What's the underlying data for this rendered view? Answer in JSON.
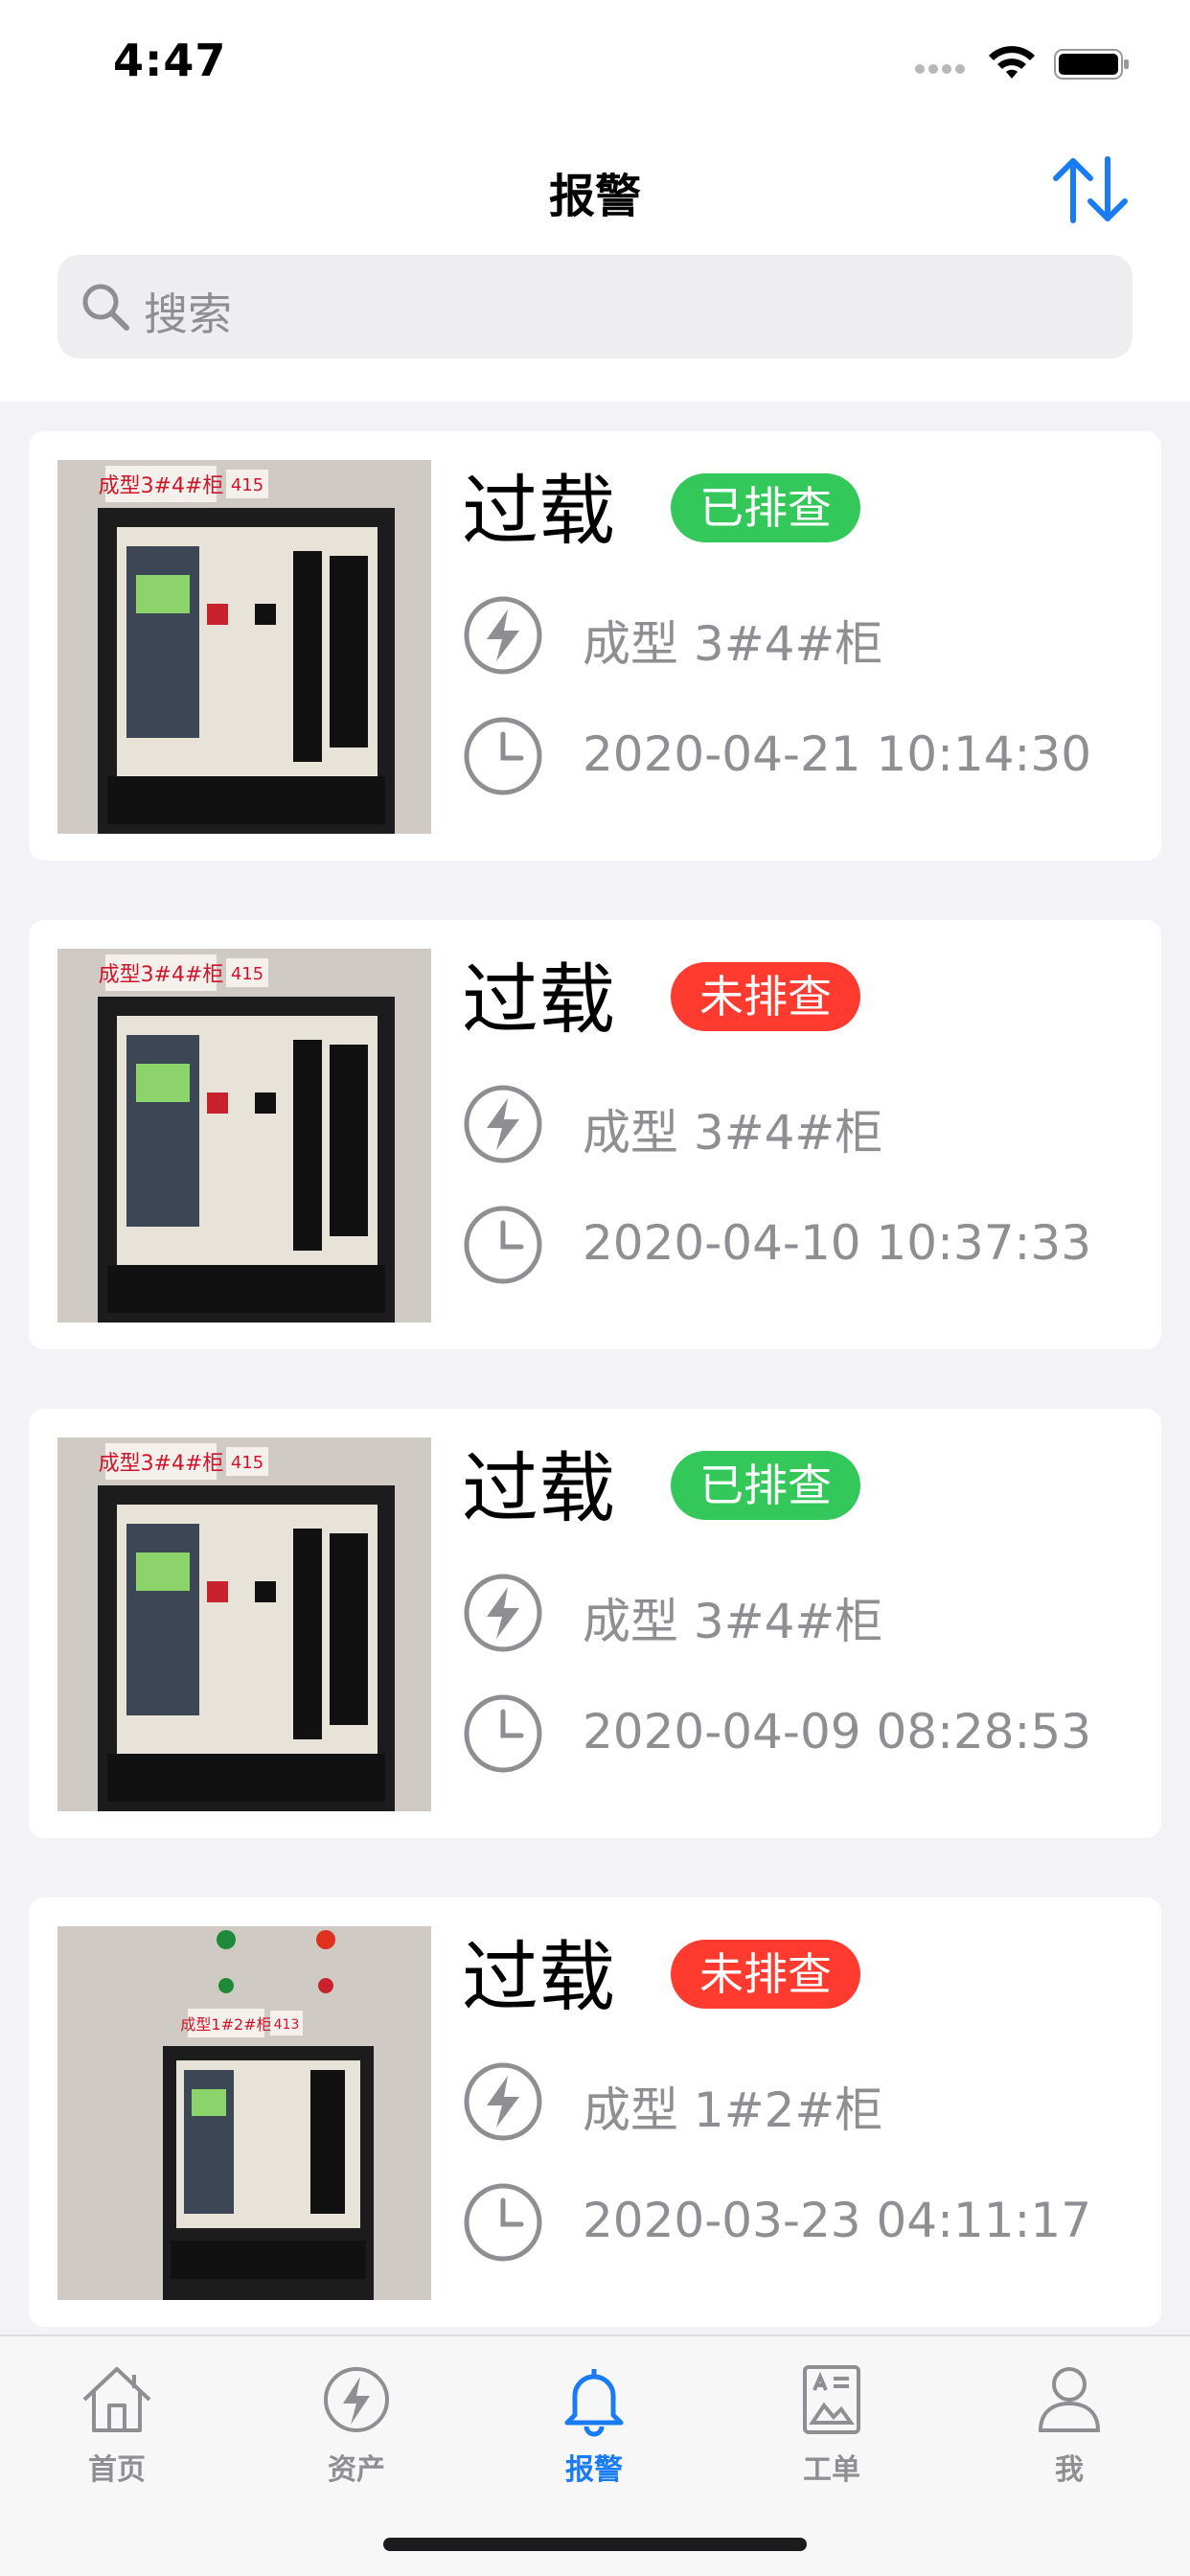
{
  "status_bar": {
    "time": "4:47"
  },
  "header": {
    "title": "报警",
    "sort_icon": "sort-arrows-icon"
  },
  "search": {
    "placeholder": "搜索"
  },
  "colors": {
    "accent": "#1a7cf5",
    "badge_done": "#34c759",
    "badge_pending": "#ff3b30",
    "secondary_text": "#8e8e93",
    "background": "#f2f2f7"
  },
  "alarms": [
    {
      "title": "过载",
      "status": "已排查",
      "status_type": "done",
      "location": "成型 3#4#柜",
      "time": "2020-04-21 10:14:30",
      "photo_label": "成型3#4#柜",
      "photo_number": "415"
    },
    {
      "title": "过载",
      "status": "未排查",
      "status_type": "pending",
      "location": "成型 3#4#柜",
      "time": "2020-04-10 10:37:33",
      "photo_label": "成型3#4#柜",
      "photo_number": "415"
    },
    {
      "title": "过载",
      "status": "已排查",
      "status_type": "done",
      "location": "成型 3#4#柜",
      "time": "2020-04-09 08:28:53",
      "photo_label": "成型3#4#柜",
      "photo_number": "415"
    },
    {
      "title": "过载",
      "status": "未排查",
      "status_type": "pending",
      "location": "成型 1#2#柜",
      "time": "2020-03-23 04:11:17",
      "photo_label": "成型1#2#柜",
      "photo_number": "413"
    }
  ],
  "tabs": [
    {
      "label": "首页",
      "icon": "home-icon",
      "active": false
    },
    {
      "label": "资产",
      "icon": "bolt-icon",
      "active": false
    },
    {
      "label": "报警",
      "icon": "bell-icon",
      "active": true
    },
    {
      "label": "工单",
      "icon": "work-order-icon",
      "active": false
    },
    {
      "label": "我",
      "icon": "person-icon",
      "active": false
    }
  ]
}
